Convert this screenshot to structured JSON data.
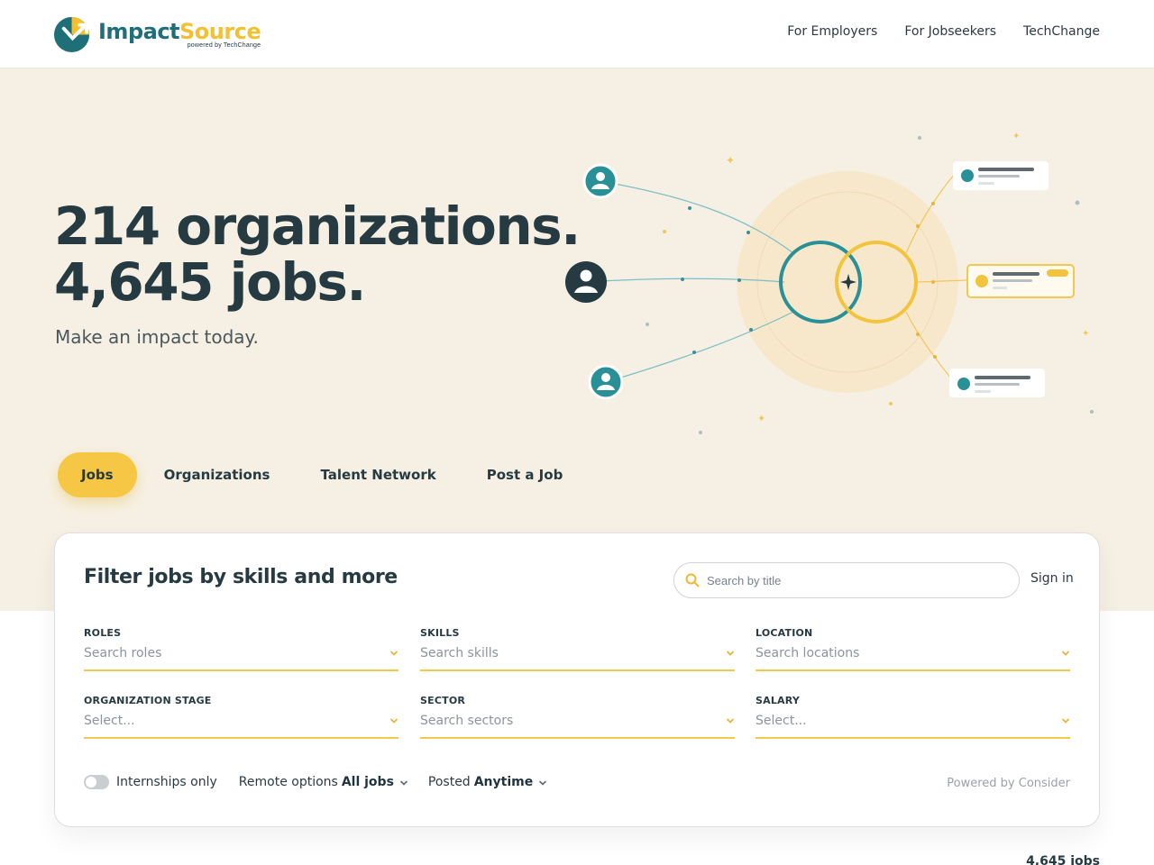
{
  "brand": {
    "name_part1": "Impact",
    "name_part2": "Source",
    "tagline": "powered by TechChange",
    "colors": {
      "teal": "#1e6f78",
      "yellow": "#f4c033"
    }
  },
  "nav": {
    "items": [
      "For Employers",
      "For Jobseekers",
      "TechChange"
    ]
  },
  "hero": {
    "headline_line1": "214 organizations.",
    "headline_line2": "4,645 jobs.",
    "subline": "Make an impact today."
  },
  "tabs": [
    {
      "label": "Jobs",
      "active": true
    },
    {
      "label": "Organizations",
      "active": false
    },
    {
      "label": "Talent Network",
      "active": false
    },
    {
      "label": "Post a Job",
      "active": false
    }
  ],
  "filter": {
    "title": "Filter jobs by skills and more",
    "search_placeholder": "Search by title",
    "signin": "Sign in",
    "fields": [
      {
        "label": "ROLES",
        "placeholder": "Search roles"
      },
      {
        "label": "SKILLS",
        "placeholder": "Search skills"
      },
      {
        "label": "LOCATION",
        "placeholder": "Search locations"
      },
      {
        "label": "ORGANIZATION STAGE",
        "placeholder": "Select..."
      },
      {
        "label": "SECTOR",
        "placeholder": "Search sectors"
      },
      {
        "label": "SALARY",
        "placeholder": "Select..."
      }
    ],
    "internships_label": "Internships only",
    "remote_label": "Remote options",
    "remote_value": "All jobs",
    "posted_label": "Posted",
    "posted_value": "Anytime",
    "powered_by": "Powered by Consider"
  },
  "results": {
    "count_label": "4,645 jobs"
  },
  "icons": [
    "search-icon",
    "chevron-down-icon",
    "user-icon",
    "sparkle-icon"
  ]
}
